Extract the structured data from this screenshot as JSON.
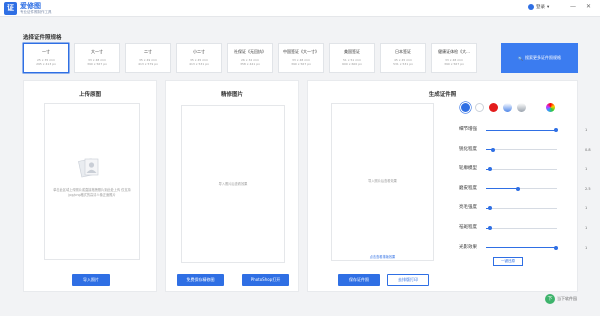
{
  "app": {
    "logo_char": "证",
    "name": "爱修图",
    "subtitle": "专业证件照制作工具",
    "user": "登录",
    "minimize": "—",
    "close": "✕"
  },
  "section_title": "选择证件照规格",
  "sizes": [
    {
      "name": "一寸",
      "mm": "25 x 35 mm",
      "px": "295 x 413 px"
    },
    {
      "name": "大一寸",
      "mm": "33 x 48 mm",
      "px": "390 x 567 px"
    },
    {
      "name": "二寸",
      "mm": "35 x 49 mm",
      "px": "413 x 579 px"
    },
    {
      "name": "小二寸",
      "mm": "35 x 45 mm",
      "px": "413 x 531 px"
    },
    {
      "name": "社保证《无回执》",
      "mm": "26 x 32 mm",
      "px": "358 x 441 px"
    },
    {
      "name": "中国签证《大一寸》",
      "mm": "33 x 48 mm",
      "px": "390 x 567 px"
    },
    {
      "name": "美国签证",
      "mm": "51 x 51 mm",
      "px": "600 x 600 px"
    },
    {
      "name": "日本签证",
      "mm": "45 x 45 mm",
      "px": "531 x 531 px"
    },
    {
      "name": "健康证体检《大...",
      "mm": "33 x 48 mm",
      "px": "390 x 567 px"
    }
  ],
  "search_button": "搜索更多证件照规格",
  "upload_panel": {
    "title": "上传原图",
    "hint": "单击此区域上传照片或直接拖拽照片到此处上传 仅支持jpg/png格式的高清人像正面照片",
    "button": "导入照片"
  },
  "refine_panel": {
    "title": "精修图片",
    "hint": "导入照片后查看效果",
    "button_save": "免费保存精修图",
    "button_ps": "PhotoShop打开"
  },
  "result_panel": {
    "title": "生成证件照",
    "hint": "导入照片后查看效果",
    "link": "点击查看排版效果",
    "button_save": "保存证件照",
    "button_print": "去排版打印",
    "reset": "一键还原"
  },
  "backgrounds": [
    {
      "name": "blue",
      "color": "#2f6fe4"
    },
    {
      "name": "white",
      "color": "#ffffff"
    },
    {
      "name": "red",
      "color": "#e31c1c"
    },
    {
      "name": "gradient-blue",
      "color": "#7ea7e8"
    },
    {
      "name": "gray",
      "color": "#b7bec8"
    },
    {
      "name": "custom",
      "color": "#ff6a00"
    }
  ],
  "sliders": [
    {
      "label": "细节增强",
      "value": "1",
      "fraction": 0.98
    },
    {
      "label": "锐化程度",
      "value": "0.8",
      "fraction": 0.1
    },
    {
      "label": "轮廓模型",
      "value": "1",
      "fraction": 0.05
    },
    {
      "label": "磨皮程度",
      "value": "2.5",
      "fraction": 0.45
    },
    {
      "label": "亮毛强度",
      "value": "1",
      "fraction": 0.05
    },
    {
      "label": "祛斑程度",
      "value": "1",
      "fraction": 0.05
    },
    {
      "label": "光影效果",
      "value": "1",
      "fraction": 0.98
    }
  ],
  "watermark": {
    "icon": "下",
    "text": "当下软件园"
  }
}
